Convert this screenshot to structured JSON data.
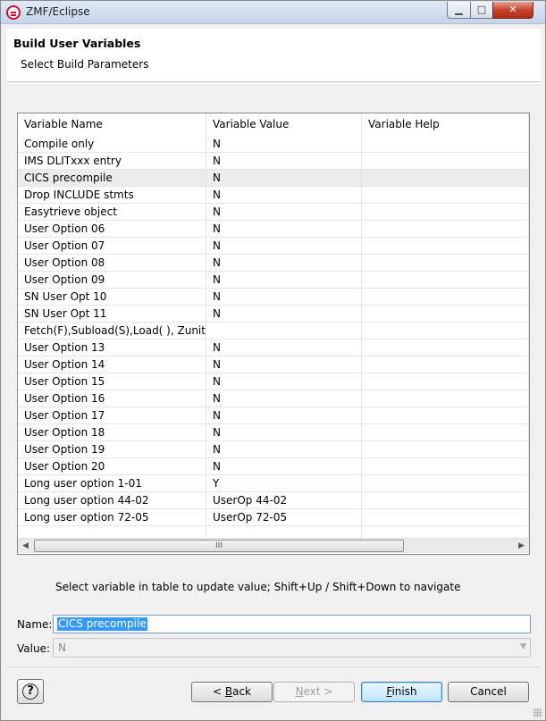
{
  "window": {
    "title": "ZMF/Eclipse",
    "minimize_glyph": "▁",
    "maximize_glyph": "□",
    "close_glyph": "✕"
  },
  "header": {
    "title": "Build User Variables",
    "subtitle": "Select Build Parameters"
  },
  "table": {
    "columns": [
      "Variable Name",
      "Variable Value",
      "Variable Help"
    ],
    "selected_row": 2,
    "rows": [
      {
        "name": "Compile only",
        "value": "N",
        "help": ""
      },
      {
        "name": "IMS DLITxxx entry",
        "value": "N",
        "help": ""
      },
      {
        "name": "CICS precompile",
        "value": "N",
        "help": ""
      },
      {
        "name": "Drop INCLUDE stmts",
        "value": "N",
        "help": ""
      },
      {
        "name": "Easytrieve object",
        "value": "N",
        "help": ""
      },
      {
        "name": "User Option 06",
        "value": "N",
        "help": ""
      },
      {
        "name": "User Option 07",
        "value": "N",
        "help": ""
      },
      {
        "name": "User Option 08",
        "value": "N",
        "help": ""
      },
      {
        "name": "User Option 09",
        "value": "N",
        "help": ""
      },
      {
        "name": "SN User Opt 10",
        "value": "N",
        "help": ""
      },
      {
        "name": "SN User Opt 11",
        "value": "N",
        "help": ""
      },
      {
        "name": "Fetch(F),Subload(S),Load( ), Zunit(U)",
        "value": "",
        "help": ""
      },
      {
        "name": "User Option 13",
        "value": "N",
        "help": ""
      },
      {
        "name": "User Option 14",
        "value": "N",
        "help": ""
      },
      {
        "name": "User Option 15",
        "value": "N",
        "help": ""
      },
      {
        "name": "User Option 16",
        "value": "N",
        "help": ""
      },
      {
        "name": "User Option 17",
        "value": "N",
        "help": ""
      },
      {
        "name": "User Option 18",
        "value": "N",
        "help": ""
      },
      {
        "name": "User Option 19",
        "value": "N",
        "help": ""
      },
      {
        "name": "User Option 20",
        "value": "N",
        "help": ""
      },
      {
        "name": "Long user option 1-01",
        "value": "Y",
        "help": ""
      },
      {
        "name": "Long user option 44-02",
        "value": "UserOp 44-02",
        "help": ""
      },
      {
        "name": "Long user option 72-05",
        "value": "UserOp 72-05",
        "help": ""
      },
      {
        "name": "",
        "value": "",
        "help": ""
      }
    ],
    "scroll_left_glyph": "◀",
    "scroll_right_glyph": "▶",
    "scroll_thumb_glyph": "III"
  },
  "hint": "Select variable in table to update value; Shift+Up / Shift+Down to navigate",
  "form": {
    "name_label": "Name:",
    "name_value": "CICS precompile",
    "value_label": "Value:",
    "value_value": "N",
    "value_dropdown_glyph": "▼"
  },
  "buttons": {
    "help_glyph": "?",
    "back_prefix": "< ",
    "back_mnemonic": "B",
    "back_rest": "ack",
    "next_prefix": "",
    "next_mnemonic": "N",
    "next_rest": "ext >",
    "finish_mnemonic": "F",
    "finish_rest": "inish",
    "cancel_label": "Cancel"
  },
  "colors": {
    "selection": "#3399ff",
    "close_button": "#c7432c",
    "default_button": "#3c7fb1"
  }
}
